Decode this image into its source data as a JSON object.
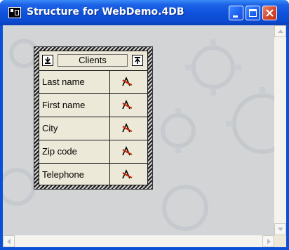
{
  "window": {
    "title": "Structure for WebDemo.4DB"
  },
  "table": {
    "name": "Clients",
    "fields": [
      {
        "name": "Last name",
        "type_icon": "alpha-field-icon"
      },
      {
        "name": "First name",
        "type_icon": "alpha-field-icon"
      },
      {
        "name": "City",
        "type_icon": "alpha-field-icon"
      },
      {
        "name": "Zip code",
        "type_icon": "alpha-field-icon"
      },
      {
        "name": "Telephone",
        "type_icon": "alpha-field-icon"
      }
    ]
  },
  "colors": {
    "titlebar": "#0b4ad0",
    "close_button": "#d4452a",
    "field_icon": "#cc2200"
  }
}
